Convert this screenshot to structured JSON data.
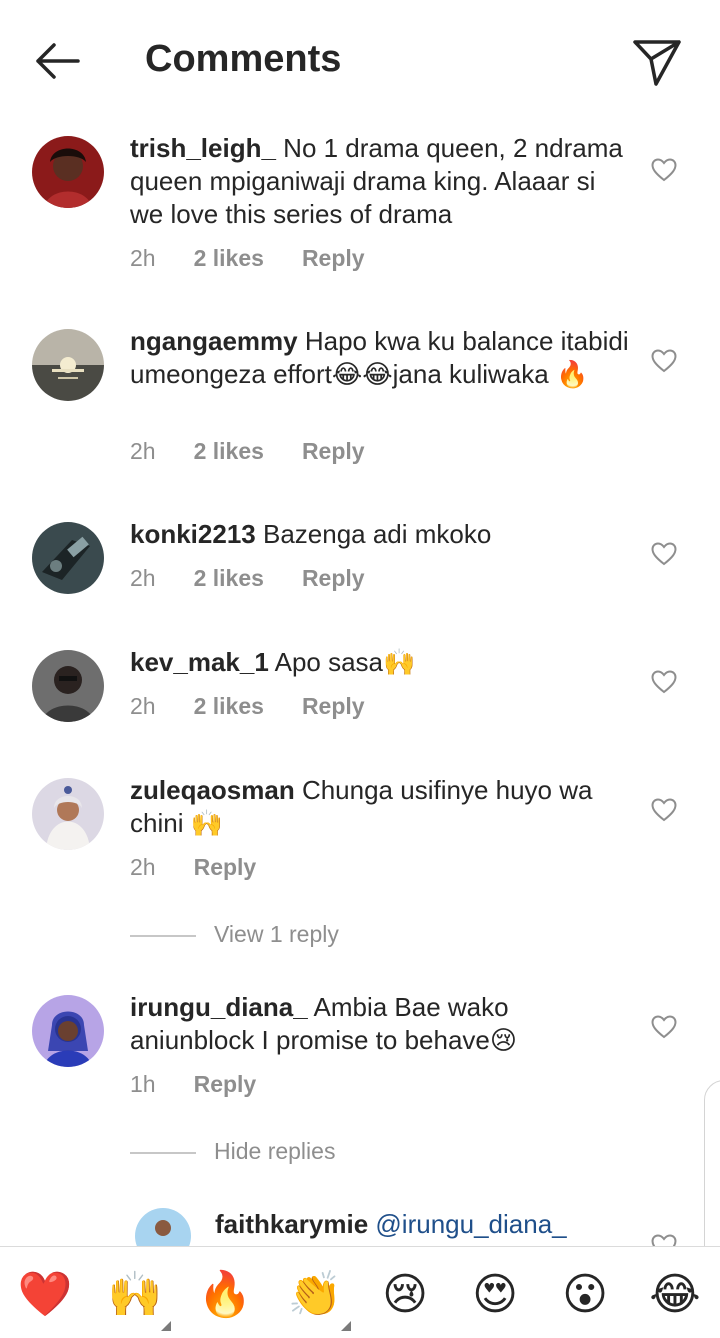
{
  "header": {
    "title": "Comments",
    "back_icon": "arrow-left-icon",
    "share_icon": "paper-plane-icon"
  },
  "comments": [
    {
      "username": "trish_leigh_",
      "text": " No 1 drama queen, 2 ndrama queen mpiganiwaji drama king. Alaaar si we love this series of drama",
      "time": "2h",
      "likes": "2 likes",
      "reply": "Reply"
    },
    {
      "username": "ngangaemmy",
      "text": " Hapo kwa ku balance itabidi umeongeza effort😂😂jana kuliwaka 🔥",
      "time": "2h",
      "likes": "2 likes",
      "reply": "Reply"
    },
    {
      "username": "konki2213",
      "text": " Bazenga adi mkoko",
      "time": "2h",
      "likes": "2 likes",
      "reply": "Reply"
    },
    {
      "username": "kev_mak_1",
      "text": " Apo sasa🙌",
      "time": "2h",
      "likes": "2 likes",
      "reply": "Reply"
    },
    {
      "username": "zuleqaosman",
      "text": " Chunga usifinye huyo wa chini 🙌",
      "time": "2h",
      "reply": "Reply"
    },
    {
      "username": "irungu_diana_",
      "text": " Ambia Bae wako aniunblock I promise to behave😢",
      "time": "1h",
      "reply": "Reply"
    },
    {
      "username": "faithkarymie",
      "mention": " @irungu_diana_",
      "text": ""
    }
  ],
  "threads": {
    "view_replies": "View 1 reply",
    "hide_replies": "Hide replies"
  },
  "reactions": [
    "❤️",
    "🙌",
    "🔥",
    "👏",
    "😢",
    "😍",
    "😮",
    "😂"
  ],
  "colors": {
    "text": "#262626",
    "secondary": "#8e8e8e",
    "mention": "#1f4f8a",
    "divider": "#dbdbdb"
  }
}
